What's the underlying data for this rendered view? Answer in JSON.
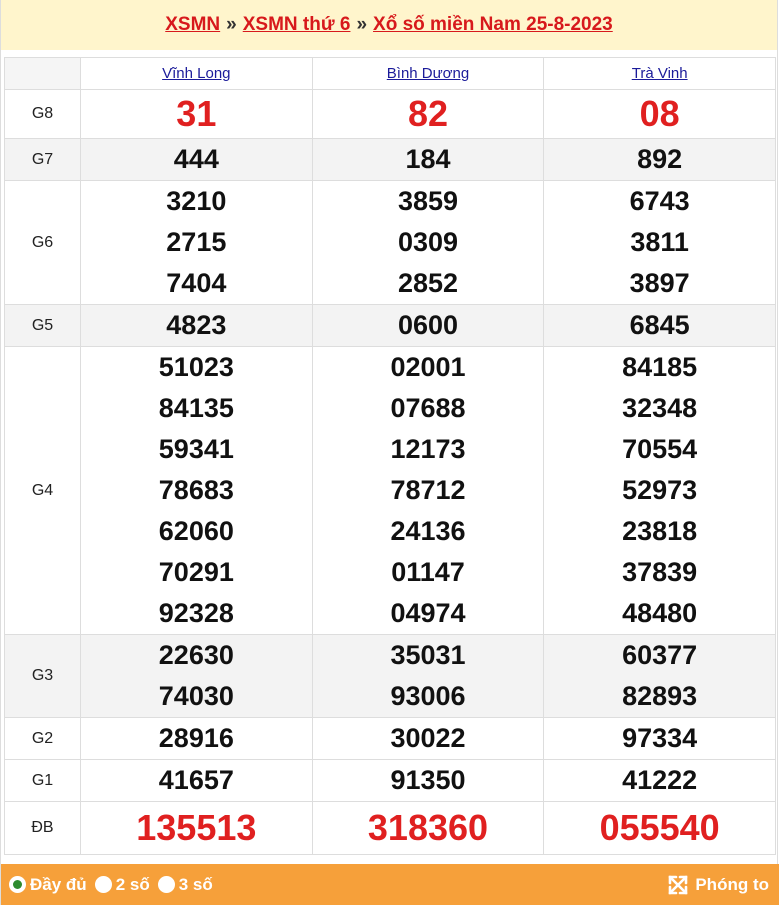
{
  "breadcrumb": {
    "link1": "XSMN",
    "link2": "XSMN thứ 6",
    "link3": "Xổ số miền Nam 25-8-2023",
    "separator": "»"
  },
  "provinces": [
    "Vĩnh Long",
    "Bình Dương",
    "Trà Vinh"
  ],
  "prizes": [
    {
      "label": "G8",
      "values": [
        [
          "31"
        ],
        [
          "82"
        ],
        [
          "08"
        ]
      ]
    },
    {
      "label": "G7",
      "values": [
        [
          "444"
        ],
        [
          "184"
        ],
        [
          "892"
        ]
      ]
    },
    {
      "label": "G6",
      "values": [
        [
          "3210",
          "2715",
          "7404"
        ],
        [
          "3859",
          "0309",
          "2852"
        ],
        [
          "6743",
          "3811",
          "3897"
        ]
      ]
    },
    {
      "label": "G5",
      "values": [
        [
          "4823"
        ],
        [
          "0600"
        ],
        [
          "6845"
        ]
      ]
    },
    {
      "label": "G4",
      "values": [
        [
          "51023",
          "84135",
          "59341",
          "78683",
          "62060",
          "70291",
          "92328"
        ],
        [
          "02001",
          "07688",
          "12173",
          "78712",
          "24136",
          "01147",
          "04974"
        ],
        [
          "84185",
          "32348",
          "70554",
          "52973",
          "23818",
          "37839",
          "48480"
        ]
      ]
    },
    {
      "label": "G3",
      "values": [
        [
          "22630",
          "74030"
        ],
        [
          "35031",
          "93006"
        ],
        [
          "60377",
          "82893"
        ]
      ]
    },
    {
      "label": "G2",
      "values": [
        [
          "28916"
        ],
        [
          "30022"
        ],
        [
          "97334"
        ]
      ]
    },
    {
      "label": "G1",
      "values": [
        [
          "41657"
        ],
        [
          "91350"
        ],
        [
          "41222"
        ]
      ]
    },
    {
      "label": "ĐB",
      "values": [
        [
          "135513"
        ],
        [
          "318360"
        ],
        [
          "055540"
        ]
      ]
    }
  ],
  "footer": {
    "options": [
      "Đầy đủ",
      "2 số",
      "3 số"
    ],
    "selected_option": "Đầy đủ",
    "zoom_label": "Phóng to"
  },
  "colors": {
    "header_bg": "#fff5cc",
    "accent_red": "#e02020",
    "footer_bg": "#f6a03a",
    "link_blue": "#1b1b9a"
  }
}
